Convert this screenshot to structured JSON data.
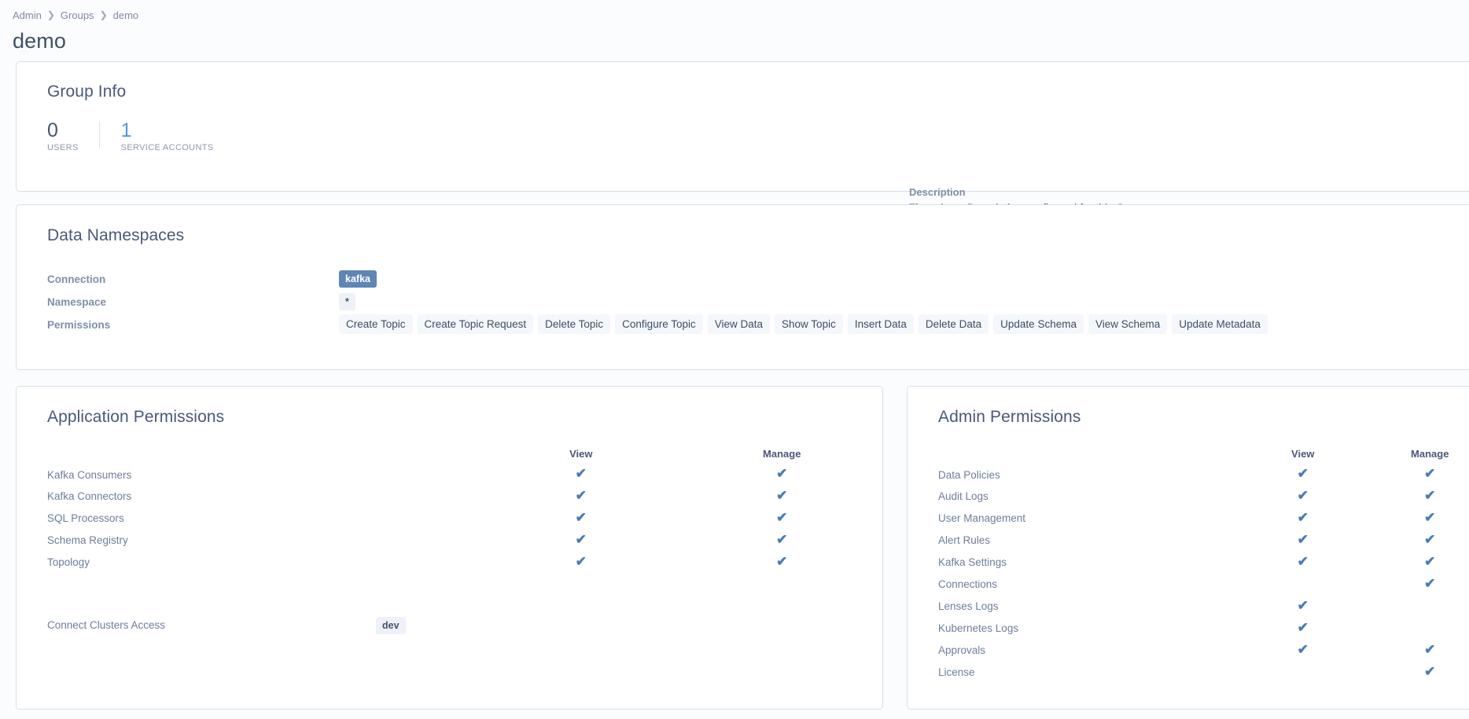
{
  "breadcrumb": {
    "items": [
      {
        "label": "Admin",
        "link": true
      },
      {
        "label": "Groups",
        "link": true
      },
      {
        "label": "demo",
        "link": false
      }
    ],
    "separator": "❯"
  },
  "page": {
    "title": "demo"
  },
  "group_info": {
    "title": "Group Info",
    "stats": [
      {
        "value": "0",
        "label": "USERS",
        "accent": false
      },
      {
        "value": "1",
        "label": "SERVICE ACCOUNTS",
        "accent": true
      }
    ],
    "description_label": "Description",
    "description_value": "There is no Description configured for this Group"
  },
  "data_namespaces": {
    "title": "Data Namespaces",
    "connection_label": "Connection",
    "connection_value": "kafka",
    "namespace_label": "Namespace",
    "namespace_value": "*",
    "permissions_label": "Permissions",
    "permissions": [
      "Create Topic",
      "Create Topic Request",
      "Delete Topic",
      "Configure Topic",
      "View Data",
      "Show Topic",
      "Insert Data",
      "Delete Data",
      "Update Schema",
      "View Schema",
      "Update Metadata"
    ]
  },
  "application_permissions": {
    "title": "Application Permissions",
    "columns": [
      "View",
      "Manage"
    ],
    "rows": [
      {
        "name": "Kafka Consumers",
        "view": true,
        "manage": true
      },
      {
        "name": "Kafka Connectors",
        "view": true,
        "manage": true
      },
      {
        "name": "SQL Processors",
        "view": true,
        "manage": true
      },
      {
        "name": "Schema Registry",
        "view": true,
        "manage": true
      },
      {
        "name": "Topology",
        "view": true,
        "manage": true
      }
    ],
    "connect_clusters_label": "Connect Clusters Access",
    "connect_clusters": [
      "dev"
    ]
  },
  "admin_permissions": {
    "title": "Admin Permissions",
    "columns": [
      "View",
      "Manage"
    ],
    "rows": [
      {
        "name": "Data Policies",
        "view": true,
        "manage": true
      },
      {
        "name": "Audit Logs",
        "view": true,
        "manage": true
      },
      {
        "name": "User Management",
        "view": true,
        "manage": true
      },
      {
        "name": "Alert Rules",
        "view": true,
        "manage": true
      },
      {
        "name": "Kafka Settings",
        "view": true,
        "manage": true
      },
      {
        "name": "Connections",
        "view": false,
        "manage": true
      },
      {
        "name": "Lenses Logs",
        "view": true,
        "manage": false
      },
      {
        "name": "Kubernetes Logs",
        "view": true,
        "manage": false
      },
      {
        "name": "Approvals",
        "view": true,
        "manage": true
      },
      {
        "name": "License",
        "view": false,
        "manage": true
      }
    ]
  },
  "icons": {
    "check": "✔"
  },
  "colors": {
    "accent": "#5897d6",
    "check": "#4a7cb4",
    "chip_solid_bg": "#5d86b5",
    "chip_bg": "#eef1f8",
    "card_border": "#d5dfe9",
    "page_bg": "#fbfcfe"
  }
}
